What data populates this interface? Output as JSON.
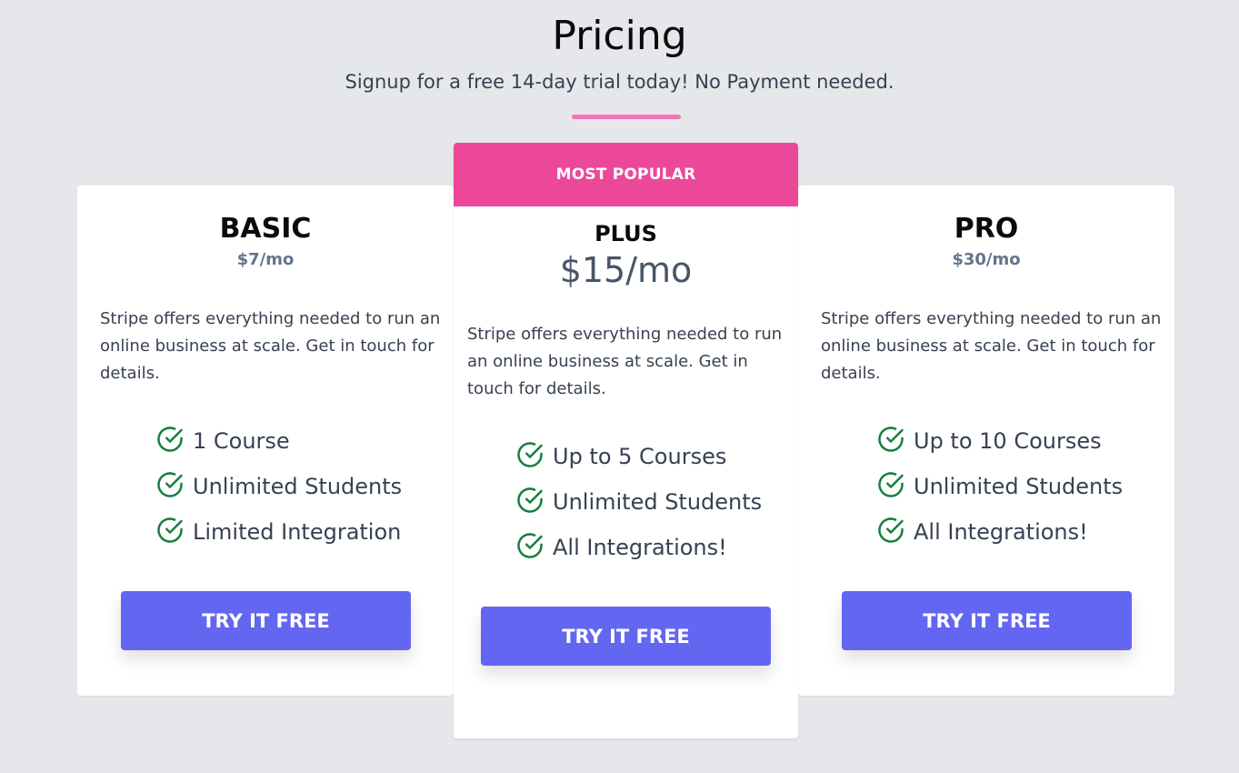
{
  "header": {
    "title": "Pricing",
    "subtitle": "Signup for a free 14-day trial today! No Payment needed.",
    "accent_color": "#f472b6"
  },
  "plans": [
    {
      "name": "BASIC",
      "price": "$7/mo",
      "description": "Stripe offers everything needed to run an online business at scale. Get in touch for details.",
      "features": [
        "1 Course",
        "Unlimited Students",
        "Limited Integration"
      ],
      "cta": "TRY IT FREE"
    },
    {
      "badge": "MOST POPULAR",
      "name": "PLUS",
      "price": "$15/mo",
      "description": "Stripe offers everything needed to run an online business at scale. Get in touch for details.",
      "features": [
        "Up to 5 Courses",
        "Unlimited Students",
        "All Integrations!"
      ],
      "cta": "TRY IT FREE"
    },
    {
      "name": "PRO",
      "price": "$30/mo",
      "description": "Stripe offers everything needed to run an online business at scale. Get in touch for details.",
      "features": [
        "Up to 10 Courses",
        "Unlimited Students",
        "All Integrations!"
      ],
      "cta": "TRY IT FREE"
    }
  ],
  "colors": {
    "background": "#e5e7eb",
    "badge": "#ec4899",
    "button": "#6366f1",
    "check": "#15803d"
  },
  "icons": {
    "feature": "check-circle-icon"
  }
}
